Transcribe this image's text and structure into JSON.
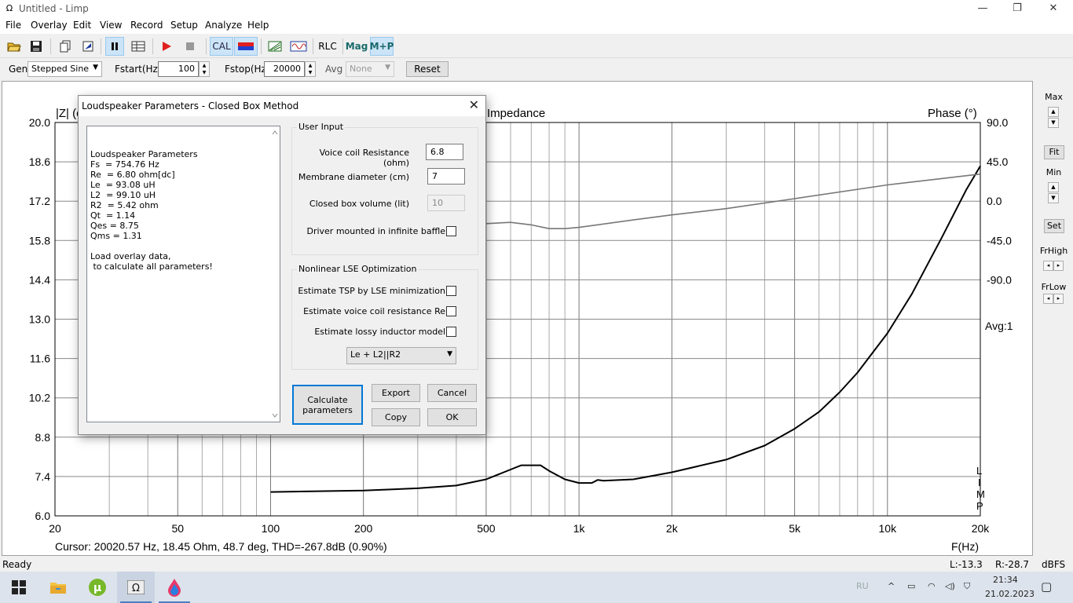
{
  "window": {
    "title": "Untitled - Limp",
    "app_icon": "omega-icon",
    "controls": [
      "minimize",
      "restore",
      "close"
    ]
  },
  "menu": [
    "File",
    "Overlay",
    "Edit",
    "View",
    "Record",
    "Setup",
    "Analyze",
    "Help"
  ],
  "toolbar": {
    "cal_label": "CAL",
    "rlc_label": "RLC",
    "mag_label": "Mag",
    "mp_label": "M+P"
  },
  "genbar": {
    "gen_label": "Gen",
    "gen_value": "Stepped Sine",
    "fstart_label": "Fstart(Hz)",
    "fstart_value": "100",
    "fstop_label": "Fstop(Hz)",
    "fstop_value": "20000",
    "avg_label": "Avg",
    "avg_value": "None",
    "reset_label": "Reset"
  },
  "plot": {
    "left_axis_label": "|Z| (o",
    "title": "Impedance",
    "right_axis_label": "Phase (°)",
    "avg_text": "Avg:1",
    "limp_letters": [
      "L",
      "I",
      "M",
      "P"
    ],
    "x_unit_label": "F(Hz)",
    "cursor_text": "Cursor: 20020.57 Hz, 18.45 Ohm, 48.7 deg, THD=-267.8dB (0.90%)"
  },
  "chart_data": {
    "type": "line",
    "title": "Impedance",
    "xlabel": "F(Hz)",
    "ylabel": "|Z| (o",
    "y2label": "Phase (°)",
    "x_scale": "log",
    "xlim": [
      20,
      20000
    ],
    "ylim": [
      6.0,
      20.0
    ],
    "y2lim": [
      -225,
      90
    ],
    "x_ticks": [
      20,
      50,
      100,
      200,
      500,
      1000,
      2000,
      5000,
      10000,
      20000
    ],
    "x_tick_labels": [
      "20",
      "50",
      "100",
      "200",
      "500",
      "1k",
      "2k",
      "5k",
      "10k",
      "20k"
    ],
    "y_ticks": [
      "20.0",
      "18.6",
      "17.2",
      "15.8",
      "14.4",
      "13.0",
      "11.6",
      "10.2",
      "8.8",
      "7.4",
      "6.0"
    ],
    "y2_ticks": [
      "90.0",
      "45.0",
      "0.0",
      "-45.0",
      "-90.0"
    ],
    "grid": true,
    "series": [
      {
        "color": "#000000",
        "axis": "left",
        "x": [
          100,
          200,
          300,
          400,
          500,
          600,
          650,
          700,
          750,
          800,
          900,
          1000,
          1100,
          1150,
          1200,
          1500,
          2000,
          3000,
          4000,
          5000,
          6000,
          7000,
          8000,
          10000,
          12000,
          15000,
          18000,
          20000
        ],
        "y": [
          6.85,
          6.9,
          6.98,
          7.08,
          7.3,
          7.65,
          7.8,
          7.8,
          7.8,
          7.6,
          7.3,
          7.17,
          7.17,
          7.28,
          7.25,
          7.3,
          7.55,
          8.0,
          8.5,
          9.1,
          9.7,
          10.4,
          11.1,
          12.5,
          13.9,
          15.9,
          17.6,
          18.45
        ]
      },
      {
        "color": "#777777",
        "axis": "right",
        "x": [
          380,
          500,
          600,
          700,
          800,
          900,
          1000,
          1500,
          2000,
          3000,
          5000,
          10000,
          20000
        ],
        "y": [
          9,
          9,
          10,
          8,
          5,
          5,
          6,
          12,
          16,
          21,
          29,
          40,
          48.7
        ]
      }
    ]
  },
  "right_panel": {
    "max_label": "Max",
    "fit_label": "Fit",
    "min_label": "Min",
    "set_label": "Set",
    "frhigh_label": "FrHigh",
    "frlow_label": "FrLow"
  },
  "statusbar": {
    "status": "Ready",
    "left_level": "L:-13.3",
    "right_level": "R:-28.7",
    "unit": "dBFS"
  },
  "dialog": {
    "title": "Loudspeaker Parameters - Closed Box Method",
    "results": [
      "Loudspeaker Parameters",
      "Fs  = 754.76 Hz",
      "Re  = 6.80 ohm[dc]",
      "Le  = 93.08 uH",
      "L2  = 99.10 uH",
      "R2  = 5.42 ohm",
      "Qt  = 1.14",
      "Qes = 8.75",
      "Qms = 1.31",
      "",
      "Load overlay data,",
      " to calculate all parameters!"
    ],
    "user_input": {
      "legend": "User Input",
      "vc_label": "Voice coil Resistance (ohm)",
      "vc_value": "6.8",
      "membrane_label": "Membrane diameter (cm)",
      "membrane_value": "7",
      "box_label": "Closed box volume (lit)",
      "box_value": "10",
      "infinite_label": "Driver mounted in infinite baffle"
    },
    "lse": {
      "legend": "Nonlinear LSE Optimization",
      "tsp_label": "Estimate TSP by LSE minimization",
      "re_label": "Estimate voice coil resistance Re",
      "lossy_label": "Estimate lossy inductor model",
      "model_value": "Le + L2||R2"
    },
    "buttons": {
      "calculate": "Calculate parameters",
      "export": "Export",
      "cancel": "Cancel",
      "copy": "Copy",
      "ok": "OK"
    }
  },
  "taskbar": {
    "lang": "RU",
    "time": "21:34",
    "date": "21.02.2023"
  }
}
